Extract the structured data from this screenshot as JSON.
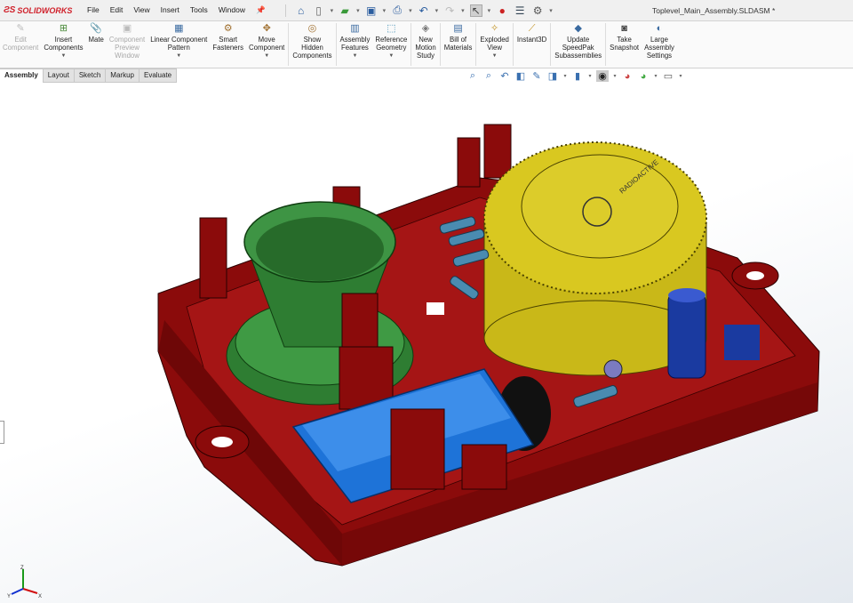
{
  "app": {
    "brand": "SOLIDWORKS",
    "document_title": "Toplevel_Main_Assembly.SLDASM *"
  },
  "menu": [
    "File",
    "Edit",
    "View",
    "Insert",
    "Tools",
    "Window"
  ],
  "ribbon": [
    {
      "label1": "Edit",
      "label2": "Component",
      "disabled": true
    },
    {
      "label1": "Insert",
      "label2": "Components",
      "dropdown": true
    },
    {
      "label1": "Mate"
    },
    {
      "label1": "Component",
      "label2": "Preview",
      "label3": "Window",
      "disabled": true
    },
    {
      "label1": "Linear Component",
      "label2": "Pattern",
      "dropdown": true
    },
    {
      "label1": "Smart",
      "label2": "Fasteners"
    },
    {
      "label1": "Move",
      "label2": "Component",
      "dropdown": true
    },
    {
      "label1": "Show",
      "label2": "Hidden",
      "label3": "Components"
    },
    {
      "label1": "Assembly",
      "label2": "Features",
      "dropdown": true
    },
    {
      "label1": "Reference",
      "label2": "Geometry",
      "dropdown": true
    },
    {
      "label1": "New",
      "label2": "Motion",
      "label3": "Study"
    },
    {
      "label1": "Bill of",
      "label2": "Materials"
    },
    {
      "label1": "Exploded",
      "label2": "View",
      "dropdown": true
    },
    {
      "label1": "Instant3D"
    },
    {
      "label1": "Update",
      "label2": "SpeedPak",
      "label3": "Subassemblies"
    },
    {
      "label1": "Take",
      "label2": "Snapshot"
    },
    {
      "label1": "Large",
      "label2": "Assembly",
      "label3": "Settings"
    }
  ],
  "tabs": [
    "Assembly",
    "Layout",
    "Sketch",
    "Markup",
    "Evaluate"
  ],
  "active_tab": "Assembly",
  "model_text": {
    "dome_label": "RADIOACTIVE"
  },
  "triad": {
    "x": "X",
    "y": "Y",
    "z": "Z"
  },
  "colors": {
    "enclosure": "#8a0a0a",
    "speaker": "#2e7d32",
    "dome": "#d4c21a",
    "battery": "#1e73d8",
    "brand": "#d0202a"
  }
}
